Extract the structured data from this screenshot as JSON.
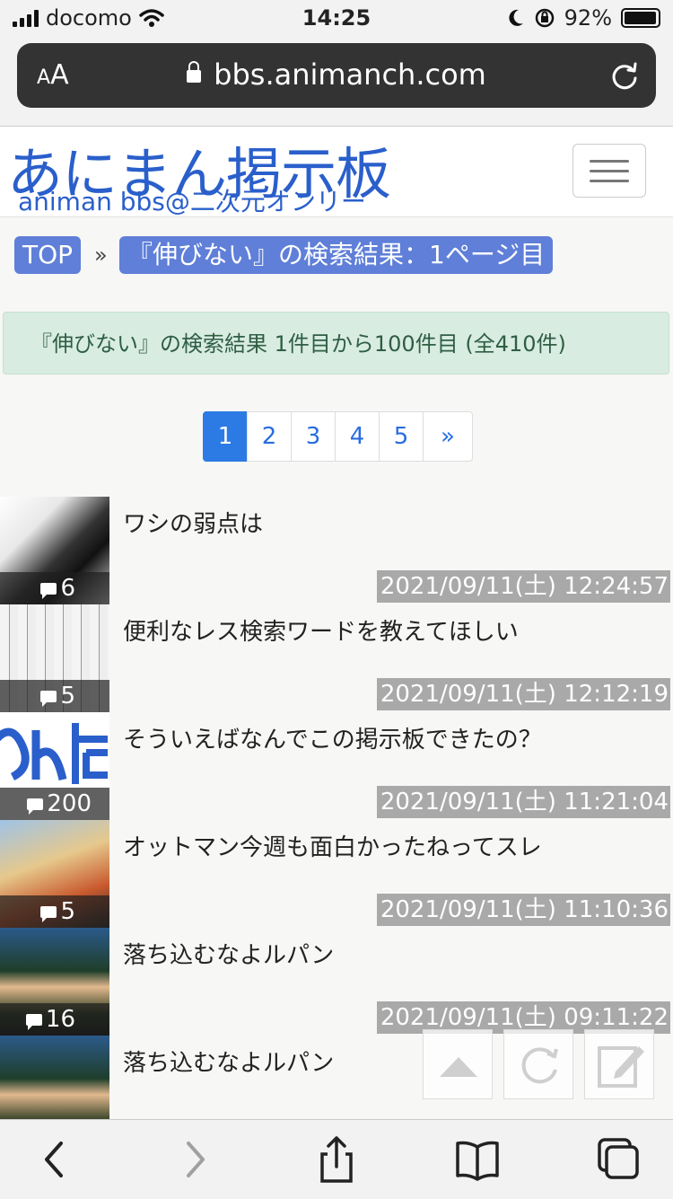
{
  "status_bar": {
    "carrier": "docomo",
    "time": "14:25",
    "battery": "92%"
  },
  "browser": {
    "aa_big": "A",
    "aa_small": "A",
    "domain": "bbs.animanch.com"
  },
  "site": {
    "logo_main": "あにまん掲示板",
    "logo_sub": "animan bbs@二次元オンリー"
  },
  "breadcrumb": {
    "top": "TOP",
    "separator": "»",
    "current": "『伸びない』の検索結果：1ページ目"
  },
  "alert": "『伸びない』の検索結果 1件目から100件目 (全410件)",
  "pagination": {
    "pages": [
      "1",
      "2",
      "3",
      "4",
      "5"
    ],
    "next": "»",
    "current": "1"
  },
  "threads": [
    {
      "title": "ワシの弱点は",
      "count": "6",
      "timestamp": "2021/09/11(土) 12:24:57"
    },
    {
      "title": "便利なレス検索ワードを教えてほしい",
      "count": "5",
      "timestamp": "2021/09/11(土) 12:12:19"
    },
    {
      "title": "そういえばなんでこの掲示板できたの？",
      "count": "200",
      "timestamp": "2021/09/11(土) 11:21:04"
    },
    {
      "title": "オットマン今週も面白かったねってスレ",
      "count": "5",
      "timestamp": "2021/09/11(土) 11:10:36"
    },
    {
      "title": "落ち込むなよルパン",
      "count": "16",
      "timestamp": "2021/09/11(土) 09:11:22"
    },
    {
      "title": "落ち込むなよルパン",
      "count": "",
      "timestamp": ""
    }
  ]
}
